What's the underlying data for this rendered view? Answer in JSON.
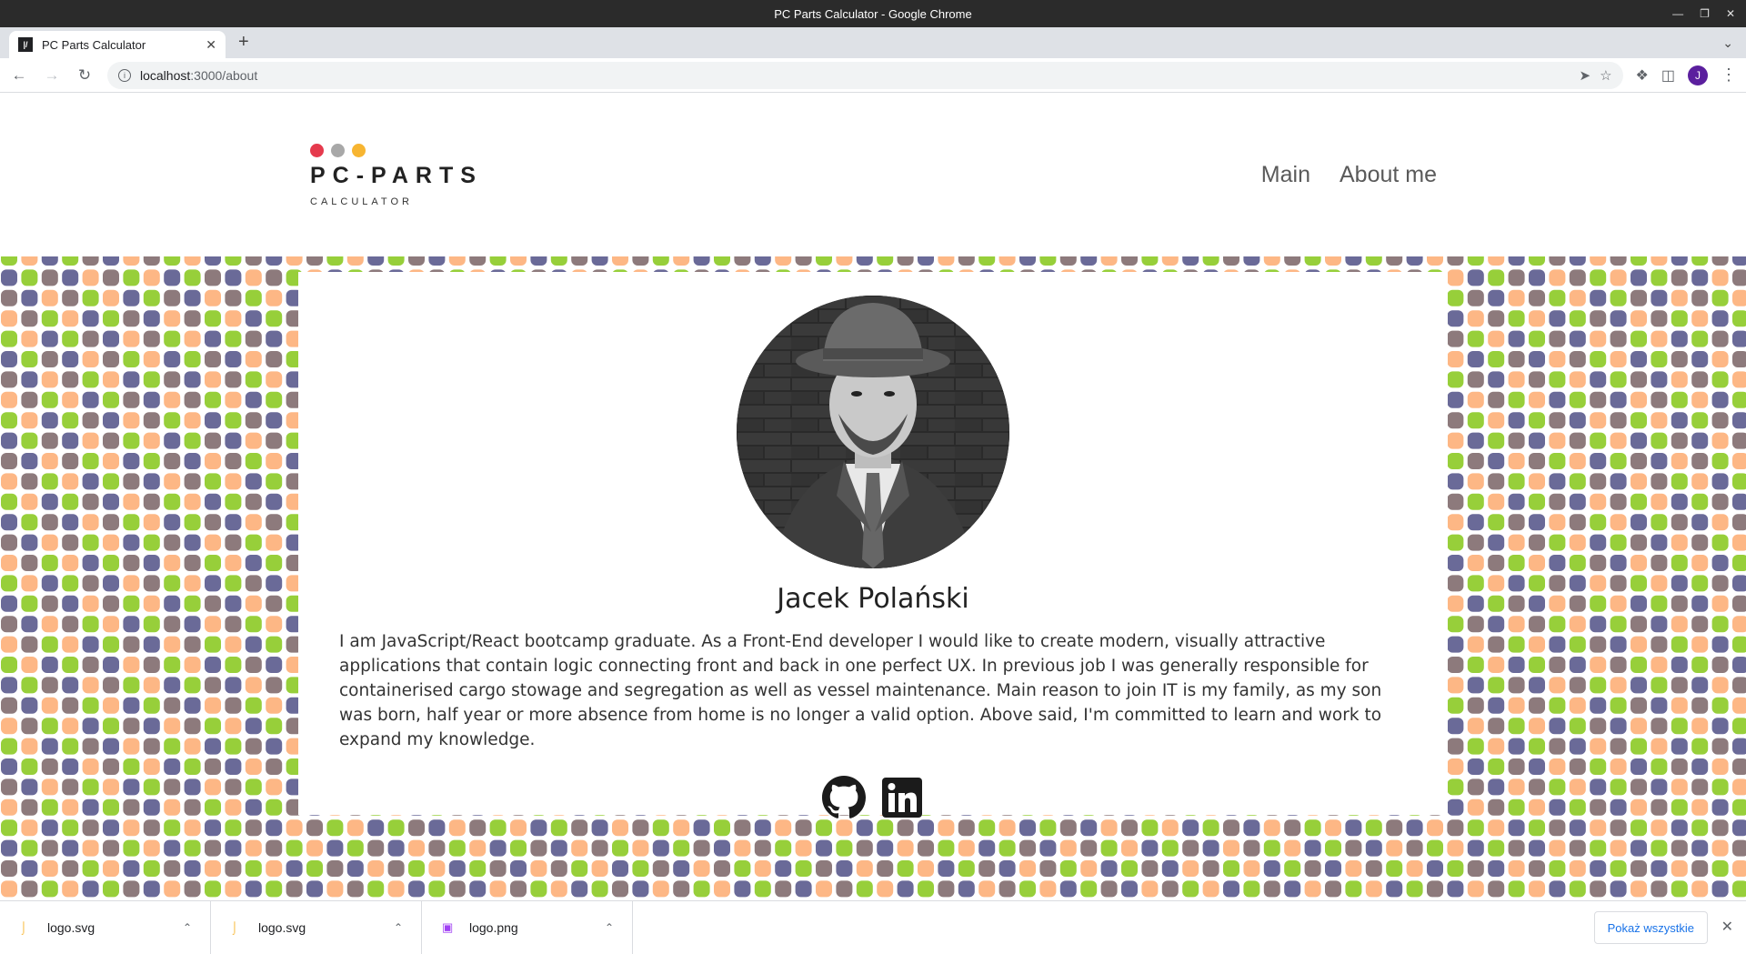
{
  "window": {
    "title": "PC Parts Calculator - Google Chrome"
  },
  "tab": {
    "title": "PC Parts Calculator",
    "favicon_text": "|/"
  },
  "address_bar": {
    "host": "localhost",
    "path": ":3000/about"
  },
  "profile": {
    "initial": "J"
  },
  "site": {
    "logo": {
      "brand": "PC-PARTS",
      "subtitle": "CALCULATOR",
      "dot_colors": [
        "#e53a4d",
        "#a8a8a8",
        "#f7b531"
      ]
    },
    "nav": {
      "main": "Main",
      "about": "About me"
    }
  },
  "profile_card": {
    "name": "Jacek Polański",
    "bio": "I am JavaScript/React bootcamp graduate. As a Front-End developer I would like to create modern, visually attractive applications that contain logic connecting front and back in one perfect UX. In previous job I was generally responsible for containerised cargo stowage and segregation as well as vessel maintenance. Main reason to join IT is my family, as my son was born, half year or more absence from home is no longer a valid option. Above said, I'm committed to learn and work to expand my knowledge.",
    "socials": [
      "github-icon",
      "linkedin-icon"
    ]
  },
  "pattern_colors": [
    "#97cf3a",
    "#fdb785",
    "#8d7a7c",
    "#6a6a98"
  ],
  "downloads": {
    "items": [
      {
        "name": "logo.svg",
        "icon": "svg-file-icon"
      },
      {
        "name": "logo.svg",
        "icon": "svg-file-icon"
      },
      {
        "name": "logo.png",
        "icon": "image-file-icon"
      }
    ],
    "show_all": "Pokaż wszystkie"
  }
}
